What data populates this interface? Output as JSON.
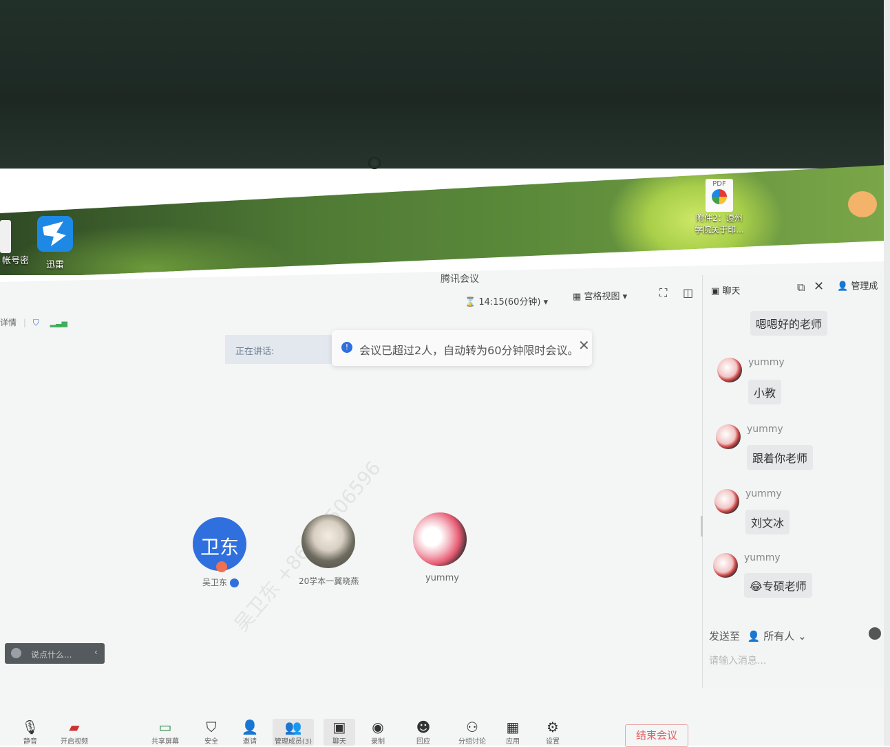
{
  "desktop": {
    "left_icon_1": "帐号密",
    "left_icon_2": "迅雷",
    "pdf_badge": "PDF",
    "pdf_file_line1": "附件2：遵州",
    "pdf_file_line2": "学院关于印..."
  },
  "window": {
    "title": "腾讯会议",
    "left_label": "详情",
    "timer": "14:15(60分钟)",
    "view_label": "宫格视图",
    "speaking_label": "正在讲话:",
    "notice_text": "会议已超过2人，自动转为60分钟限时会议。",
    "say_placeholder": "说点什么..."
  },
  "participants": [
    {
      "avatar_text": "卫东",
      "name": "吴卫东"
    },
    {
      "name": "20学本一冀晓燕"
    },
    {
      "name": "yummy"
    }
  ],
  "watermark": "吴卫东 +86765506596",
  "chat": {
    "tab_label": "聊天",
    "manage_label": "管理成",
    "messages": [
      {
        "text": "嗯嗯好的老师"
      },
      {
        "sender": "yummy",
        "text": "小教"
      },
      {
        "sender": "yummy",
        "text": "跟着你老师"
      },
      {
        "sender": "yummy",
        "text": "刘文冰"
      },
      {
        "sender": "yummy",
        "text": "😂专硕老师"
      }
    ],
    "send_to_label": "发送至",
    "send_to_target": "所有人",
    "input_placeholder": "请输入消息..."
  },
  "toolbar": {
    "mute": "静音",
    "video": "开启视频",
    "share": "共享屏幕",
    "security": "安全",
    "invite": "邀请",
    "members": "管理成员(3)",
    "chat": "聊天",
    "record": "录制",
    "react": "回应",
    "breakout": "分组讨论",
    "apps": "应用",
    "settings": "设置",
    "end": "结束会议"
  }
}
